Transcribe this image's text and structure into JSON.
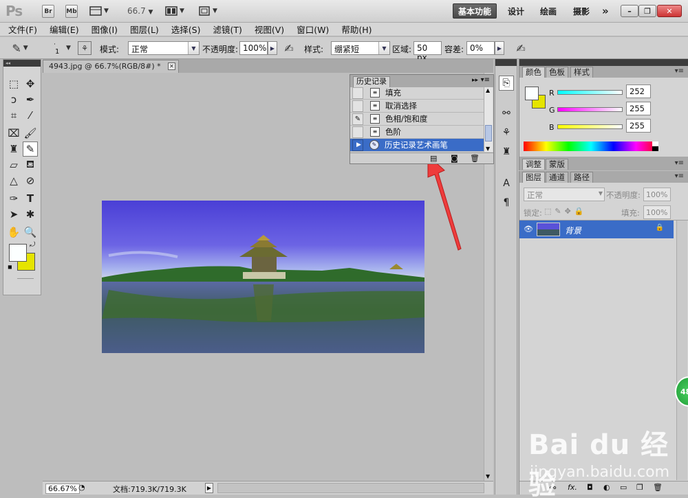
{
  "appbar": {
    "logo": "Ps",
    "br_label": "Br",
    "mb_label": "Mb",
    "zoom": "66.7",
    "workspaces": [
      "基本功能",
      "设计",
      "绘画",
      "摄影"
    ],
    "more": "»"
  },
  "menu": [
    "文件(F)",
    "编辑(E)",
    "图像(I)",
    "图层(L)",
    "选择(S)",
    "滤镜(T)",
    "视图(V)",
    "窗口(W)",
    "帮助(H)"
  ],
  "options": {
    "brush_size": "1",
    "mode_label": "模式:",
    "mode_value": "正常",
    "opacity_label": "不透明度:",
    "opacity_value": "100%",
    "style_label": "样式:",
    "style_value": "绷紧短",
    "area_label": "区域:",
    "area_value": "50 px",
    "tolerance_label": "容差:",
    "tolerance_value": "0%"
  },
  "document": {
    "tab_title": "4943.jpg @ 66.7%(RGB/8#) *",
    "status_zoom": "66.67%",
    "status_doc": "文档:719.3K/719.3K"
  },
  "history": {
    "title": "历史记录",
    "items": [
      "填充",
      "取消选择",
      "色相/饱和度",
      "色阶",
      "历史记录艺术画笔"
    ]
  },
  "color_panel": {
    "tabs": [
      "颜色",
      "色板",
      "样式"
    ],
    "r_label": "R",
    "r_value": "252",
    "g_label": "G",
    "g_value": "255",
    "b_label": "B",
    "b_value": "255"
  },
  "adjust_panel": {
    "tabs": [
      "调整",
      "蒙版"
    ]
  },
  "layers_panel": {
    "tabs": [
      "图层",
      "通道",
      "路径"
    ],
    "blend_mode": "正常",
    "opacity_label": "不透明度:",
    "opacity_value": "100%",
    "lock_label": "锁定:",
    "fill_label": "填充:",
    "fill_value": "100%",
    "layer_name": "背景",
    "footer_fx": "fx."
  },
  "watermark": {
    "brand": "Bai du 经验",
    "url": "jingyan.baidu.com"
  },
  "badge": "48",
  "colors": {
    "selection": "#3a6cc7",
    "background_swatch": "#e5e400",
    "arrow": "#ee3c3c"
  }
}
